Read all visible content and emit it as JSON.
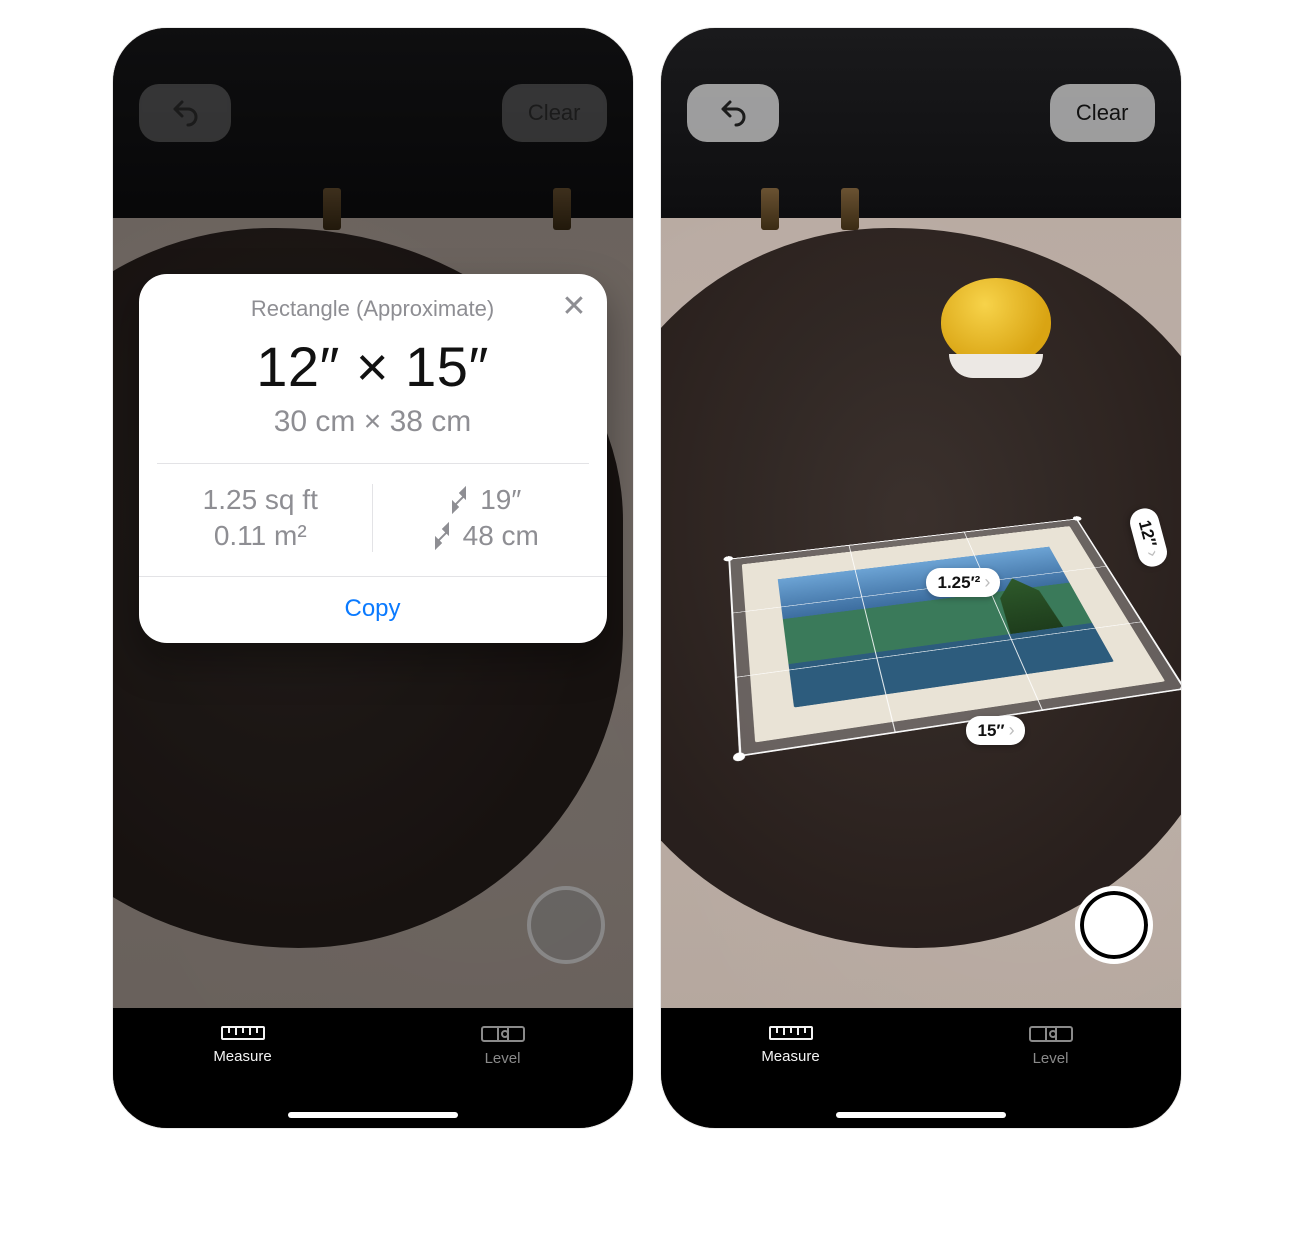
{
  "buttons": {
    "clear": "Clear",
    "copy": "Copy"
  },
  "tabs": {
    "measure": "Measure",
    "level": "Level"
  },
  "popup": {
    "title": "Rectangle (Approximate)",
    "primary": "12″ × 15″",
    "secondary": "30 cm × 38 cm",
    "area_imperial": "1.25 sq ft",
    "area_metric": "0.11 m²",
    "diagonal_imperial": "19″",
    "diagonal_metric": "48 cm"
  },
  "ar_labels": {
    "area": "1.25′²",
    "width": "15″",
    "height": "12″"
  }
}
